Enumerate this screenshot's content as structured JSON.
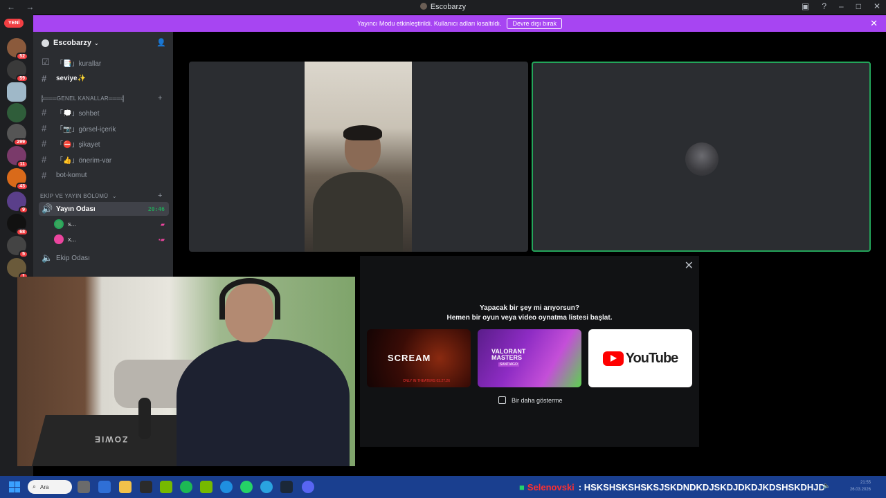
{
  "window": {
    "title": "Escobarzy",
    "nav": "← →"
  },
  "banner": {
    "text": "Yayıncı Modu etkinleştirildi. Kullanıcı adları kısaltıldı.",
    "button": "Devre dışı bırak"
  },
  "server_rail": {
    "new_label": "YENİ",
    "badges": [
      "52",
      "59",
      "299",
      "11",
      "43",
      "9",
      "68",
      "5",
      "1"
    ]
  },
  "server": {
    "name": "Escobarzy",
    "channels_top": [
      {
        "icon": "rules-icon",
        "label": "「📑」kurallar",
        "style": "normal"
      },
      {
        "icon": "hash-icon",
        "label": "seviye✨",
        "style": "white"
      }
    ],
    "category1": "╠═══GENEL KANALLAR═══╣",
    "channels_general": [
      {
        "label": "「💭」sohbet"
      },
      {
        "label": "「📷」görsel-içerik"
      },
      {
        "label": "「⛔」şikayet"
      },
      {
        "label": "「👍」önerim-var"
      },
      {
        "label": "bot-komut"
      }
    ],
    "category2": "EKİP VE YAYIN BÖLÜMÜ",
    "voice_channel": {
      "label": "Yayın Odası",
      "time": "20:46"
    },
    "voice_users": [
      {
        "name": "s...",
        "color": "#3ba55d"
      },
      {
        "name": "x...",
        "color": "#eb459e"
      }
    ],
    "voice_channel2": "Ekip Odası"
  },
  "activity": {
    "line1": "Yapacak bir şey mi arıyorsun?",
    "line2": "Hemen bir oyun veya video oynatma listesi başlat.",
    "cards": {
      "scream_title": "SCREAM",
      "scream_date": "ONLY IN THEATERS 03.27.26",
      "valorant_title": "VALORANT\nMASTERS",
      "valorant_sub": "SANTIAGO",
      "youtube": "YouTube"
    },
    "checkbox_label": "Bir daha gösterme"
  },
  "webcam": {
    "desk_text": "ZOWIE"
  },
  "taskbar": {
    "search": "Ara",
    "ticker_name": "Selenovski",
    "ticker_text": ": HSKSHSKSHSKSJSKDNDKDJSKDJDKDJKDSHSKDHJD",
    "time": "21:55",
    "date": "26.03.2026"
  },
  "colors": {
    "accent": "#a745f2",
    "speaking": "#23a55a",
    "taskbar": "#1a3f8f"
  }
}
